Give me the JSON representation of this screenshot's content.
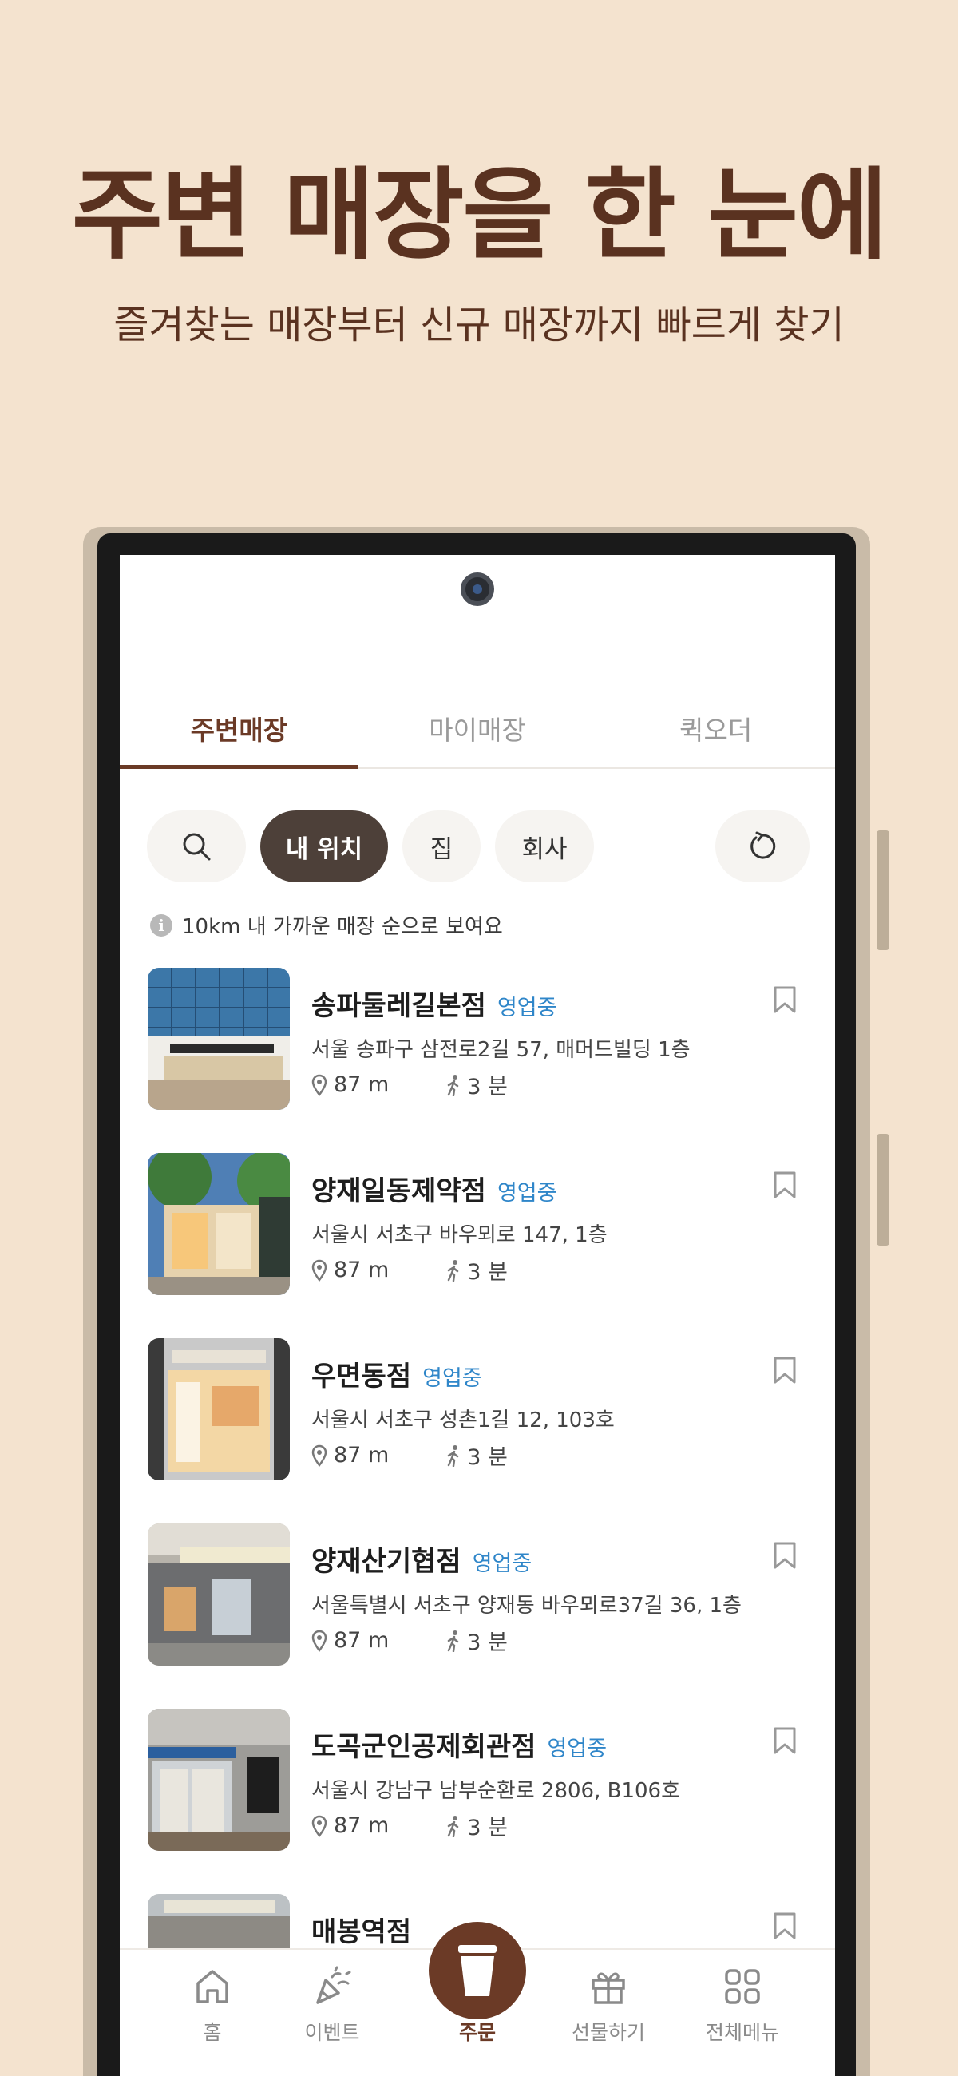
{
  "promo": {
    "headline": "주변 매장을 한 눈에",
    "subline": "즐겨찾는 매장부터 신규 매장까지 빠르게 찾기"
  },
  "colors": {
    "background": "#f4e3cf",
    "brand_brown": "#6b3a26",
    "status_blue": "#2f86c9",
    "chip_active": "#4d4039"
  },
  "tabs": [
    {
      "label": "주변매장",
      "active": true
    },
    {
      "label": "마이매장",
      "active": false
    },
    {
      "label": "퀵오더",
      "active": false
    }
  ],
  "filters": {
    "search_icon": "search-icon",
    "chips": [
      {
        "label": "내 위치",
        "active": true
      },
      {
        "label": "집",
        "active": false
      },
      {
        "label": "회사",
        "active": false
      }
    ],
    "refresh_icon": "refresh-icon"
  },
  "notice": {
    "icon": "i",
    "text": "10km 내 가까운 매장 순으로 보여요"
  },
  "stores": [
    {
      "name": "송파둘레길본점",
      "status": "영업중",
      "address": "서울 송파구 삼전로2길 57, 매머드빌딩 1층",
      "distance": "87 m",
      "walk": "3 분"
    },
    {
      "name": "양재일동제약점",
      "status": "영업중",
      "address": "서울시 서초구 바우뫼로 147, 1층",
      "distance": "87 m",
      "walk": "3 분"
    },
    {
      "name": "우면동점",
      "status": "영업중",
      "address": "서울시 서초구 성촌1길 12, 103호",
      "distance": "87 m",
      "walk": "3 분"
    },
    {
      "name": "양재산기협점",
      "status": "영업중",
      "address": "서울특별시 서초구 양재동 바우뫼로37길 36, 1층",
      "distance": "87 m",
      "walk": "3 분"
    },
    {
      "name": "도곡군인공제회관점",
      "status": "영업중",
      "address": "서울시 강남구 남부순환로 2806, B106호",
      "distance": "87 m",
      "walk": "3 분"
    },
    {
      "name": "매봉역점",
      "status": "",
      "address": "",
      "distance": "",
      "walk": ""
    }
  ],
  "bottom_nav": [
    {
      "label": "홈",
      "icon": "home-icon",
      "active": false
    },
    {
      "label": "이벤트",
      "icon": "party-popper-icon",
      "active": false
    },
    {
      "label": "주문",
      "icon": "cup-icon",
      "active": true
    },
    {
      "label": "선물하기",
      "icon": "gift-icon",
      "active": false
    },
    {
      "label": "전체메뉴",
      "icon": "grid-icon",
      "active": false
    }
  ]
}
